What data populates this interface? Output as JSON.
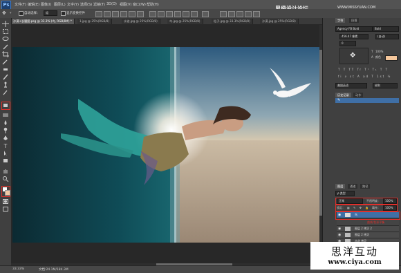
{
  "app": {
    "logo": "Ps"
  },
  "menu": [
    "文件(F)",
    "编辑(E)",
    "图像(I)",
    "图层(L)",
    "文字(Y)",
    "选择(S)",
    "滤镜(T)",
    "3D(D)",
    "视图(V)",
    "窗口(W)",
    "帮助(H)"
  ],
  "options_bar": {
    "auto_select_label": "自动选择：",
    "auto_select_value": "组",
    "show_transform_label": "显示变换控件"
  },
  "tabs": [
    {
      "label": "沙漠+长腿图.psg @ 33.3% (鸟, RGB/8#) *",
      "active": true
    },
    {
      "label": "1.jpg @ 25%(RGB/8)",
      "active": false
    },
    {
      "label": "水波.jpg @ 25%(RGB/8)",
      "active": false
    },
    {
      "label": "鸟.jpg @ 25%(RGB/8)",
      "active": false
    },
    {
      "label": "粒子.jpg @ 33.3%(RGB/8)",
      "active": false
    },
    {
      "label": "沙漠.jpg @ 25%(RGB/8)",
      "active": false
    }
  ],
  "watermark": {
    "top_cn": "思缘设计论坛",
    "top_site": "WWW.MISSYUAN.COM",
    "box_cn": "思洋互动",
    "box_url": "www.ciya.com"
  },
  "status": {
    "zoom": "33.33%",
    "doc": "文档:24.1M/184.3M"
  },
  "character_panel": {
    "tabs": [
      "字符",
      "段落"
    ],
    "font": "Agency FB Bold",
    "style": "Bold",
    "size": "456.47 像素",
    "leading": "(自动)",
    "tracking": "0",
    "scale_v": "100%",
    "scale_h": "100%",
    "baseline": "0 像素",
    "color_label": "颜色",
    "language": "美国英语",
    "aa": "锐利"
  },
  "history_panel": {
    "tabs": [
      "历史记录",
      "动作"
    ]
  },
  "layers_panel": {
    "tabs": [
      "图层",
      "通道",
      "路径"
    ],
    "kind_label": "ρ 类型",
    "blend_mode": "正常",
    "opacity_label": "不透明度：",
    "opacity": "100%",
    "lock_label": "锁定：",
    "fill_label": "填充：",
    "fill": "100%",
    "layers": [
      {
        "name": "鸟",
        "selected": true
      },
      {
        "name": "图层 2 拷贝 2",
        "selected": false
      },
      {
        "name": "图层 2 拷贝",
        "selected": false
      },
      {
        "name": "水花 拷贝",
        "selected": false
      }
    ],
    "extra_label": "曲线/色彩平衡"
  },
  "colors": {
    "accent_red": "#e0302b",
    "fg": "#ffffff",
    "bg": "#f2c8a4",
    "swatch": "#f5c79c"
  }
}
